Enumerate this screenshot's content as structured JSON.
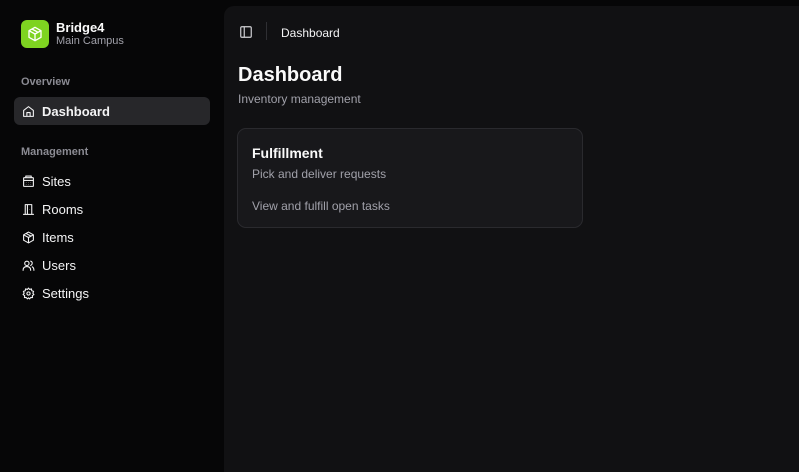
{
  "brand": {
    "name": "Bridge4",
    "subtitle": "Main Campus",
    "icon": "box-icon",
    "accent_color": "#7ed321"
  },
  "sidebar": {
    "overview_label": "Overview",
    "management_label": "Management",
    "overview_items": [
      {
        "label": "Dashboard",
        "icon": "home-icon",
        "active": true
      }
    ],
    "management_items": [
      {
        "label": "Sites",
        "icon": "building-icon"
      },
      {
        "label": "Rooms",
        "icon": "door-icon"
      },
      {
        "label": "Items",
        "icon": "package-icon"
      },
      {
        "label": "Users",
        "icon": "users-icon"
      },
      {
        "label": "Settings",
        "icon": "gear-icon"
      }
    ]
  },
  "topbar": {
    "toggle_icon": "sidebar-toggle-icon",
    "breadcrumb": "Dashboard"
  },
  "main": {
    "title": "Dashboard",
    "subtitle": "Inventory management",
    "cards": [
      {
        "title": "Fulfillment",
        "description": "Pick and deliver requests",
        "body": "View and fulfill open tasks"
      }
    ]
  }
}
